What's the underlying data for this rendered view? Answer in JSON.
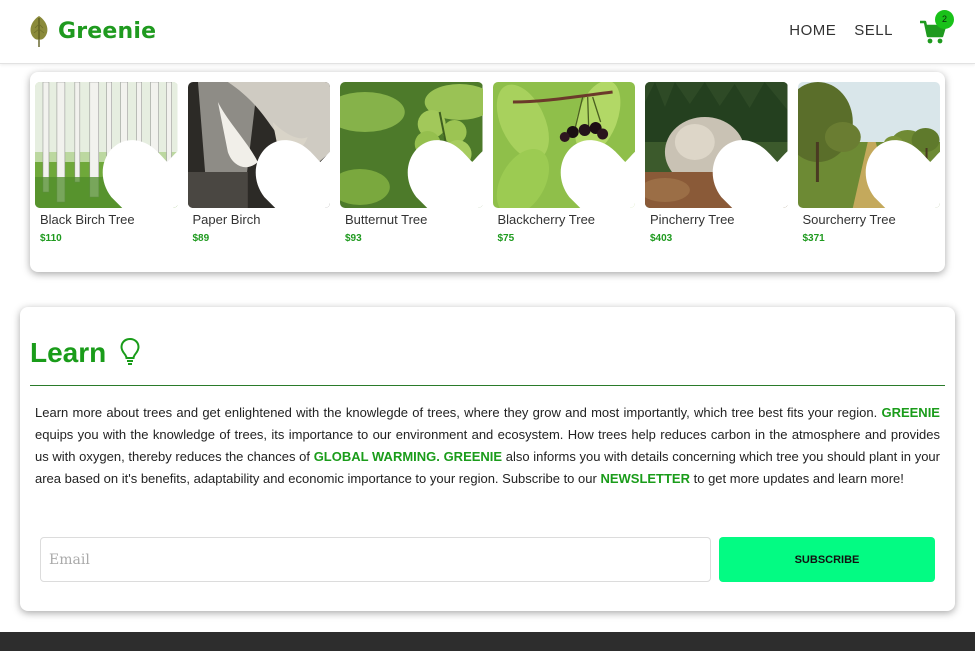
{
  "header": {
    "brand": "Greenie",
    "nav": [
      "HOME",
      "SELL"
    ],
    "cart_count": "2"
  },
  "products": [
    {
      "name": "Black Birch Tree",
      "price": "$110",
      "image": "birch-forest"
    },
    {
      "name": "Paper Birch",
      "price": "$89",
      "image": "birch-bark"
    },
    {
      "name": "Butternut Tree",
      "price": "$93",
      "image": "butternut-fruit"
    },
    {
      "name": "Blackcherry Tree",
      "price": "$75",
      "image": "black-cherries"
    },
    {
      "name": "Pincherry Tree",
      "price": "$403",
      "image": "pincherry-shrub"
    },
    {
      "name": "Sourcherry Tree",
      "price": "$371",
      "image": "cherry-orchard"
    }
  ],
  "learn": {
    "title": "Learn",
    "text": {
      "p1": "Learn more about trees and get enlightened with the knowlegde of trees, where they grow and most importantly, which tree best fits your region.",
      "h1": "GREENIE",
      "p2": " equips you with the knowledge of trees, its importance to our environment and ecosystem. How trees help reduces carbon in the atmosphere and provides us with oxygen, thereby reduces the chances of ",
      "h2": "GLOBAL WARMING.",
      "h3": "GREENIE",
      "p3": " also informs you with details concerning which tree you should plant in your area based on it's benefits, adaptability and economic importance to your region. Subscribe to our ",
      "h4": "NEWSLETTER",
      "p4": " to get more updates and learn more!"
    },
    "email_placeholder": "Email",
    "subscribe_label": "SUBSCRIBE"
  },
  "colors": {
    "brand_green": "#1f9a1f",
    "accent_button": "#03fb83",
    "footer": "#2d2d2d"
  }
}
